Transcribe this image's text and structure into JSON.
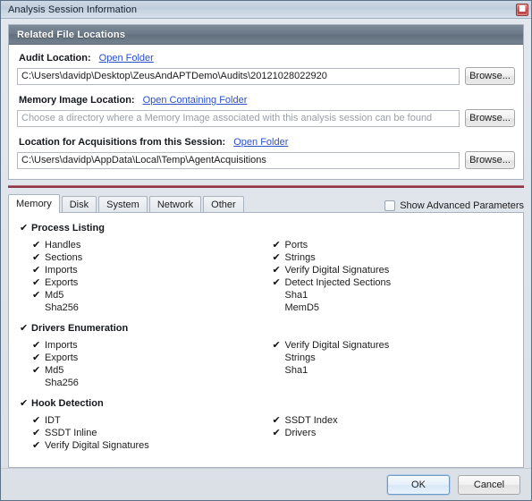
{
  "window": {
    "title": "Analysis Session Information",
    "close_icon": "close-icon",
    "close_glyph": "■"
  },
  "related_files": {
    "header": "Related File Locations",
    "rows": [
      {
        "label": "Audit Location:",
        "link": "Open Folder",
        "value": "C:\\Users\\davidp\\Desktop\\ZeusAndAPTDemo\\Audits\\20121028022920",
        "placeholder": "",
        "browse_label": "Browse..."
      },
      {
        "label": "Memory Image Location:",
        "link": "Open Containing Folder",
        "value": "",
        "placeholder": "Choose a directory where a Memory Image associated with this analysis session can be found",
        "browse_label": "Browse..."
      },
      {
        "label": "Location for Acquisitions from this Session:",
        "link": "Open Folder",
        "value": "C:\\Users\\davidp\\AppData\\Local\\Temp\\AgentAcquisitions",
        "placeholder": "",
        "browse_label": "Browse..."
      }
    ]
  },
  "tabs": [
    {
      "label": "Memory",
      "active": true
    },
    {
      "label": "Disk",
      "active": false
    },
    {
      "label": "System",
      "active": false
    },
    {
      "label": "Network",
      "active": false
    },
    {
      "label": "Other",
      "active": false
    }
  ],
  "advanced": {
    "label": "Show Advanced Parameters",
    "checked": false
  },
  "options": {
    "sections": [
      {
        "title": "Process Listing",
        "checked": true,
        "left": [
          {
            "label": "Handles",
            "checked": true
          },
          {
            "label": "Sections",
            "checked": true
          },
          {
            "label": "Imports",
            "checked": true
          },
          {
            "label": "Exports",
            "checked": true
          },
          {
            "label": "Md5",
            "checked": true
          },
          {
            "label": "Sha256",
            "checked": false
          }
        ],
        "right": [
          {
            "label": "Ports",
            "checked": true
          },
          {
            "label": "Strings",
            "checked": true
          },
          {
            "label": "Verify Digital Signatures",
            "checked": true
          },
          {
            "label": "Detect Injected Sections",
            "checked": true
          },
          {
            "label": "Sha1",
            "checked": false
          },
          {
            "label": "MemD5",
            "checked": false
          }
        ]
      },
      {
        "title": "Drivers Enumeration",
        "checked": true,
        "left": [
          {
            "label": "Imports",
            "checked": true
          },
          {
            "label": "Exports",
            "checked": true
          },
          {
            "label": "Md5",
            "checked": true
          },
          {
            "label": "Sha256",
            "checked": false
          }
        ],
        "right": [
          {
            "label": "Verify Digital Signatures",
            "checked": true
          },
          {
            "label": "Strings",
            "checked": false
          },
          {
            "label": "Sha1",
            "checked": false
          }
        ]
      },
      {
        "title": "Hook Detection",
        "checked": true,
        "left": [
          {
            "label": "IDT",
            "checked": true
          },
          {
            "label": "SSDT Inline",
            "checked": true
          },
          {
            "label": "Verify Digital Signatures",
            "checked": true
          }
        ],
        "right": [
          {
            "label": "SSDT Index",
            "checked": true
          },
          {
            "label": "Drivers",
            "checked": true
          }
        ]
      }
    ],
    "tick_glyph": "✔"
  },
  "footer": {
    "ok_label": "OK",
    "cancel_label": "Cancel"
  },
  "colors": {
    "accent_separator": "#8e3545",
    "group_header_bg": "#6b7988",
    "link": "#2a50c8",
    "close_button": "#c63f3f"
  }
}
